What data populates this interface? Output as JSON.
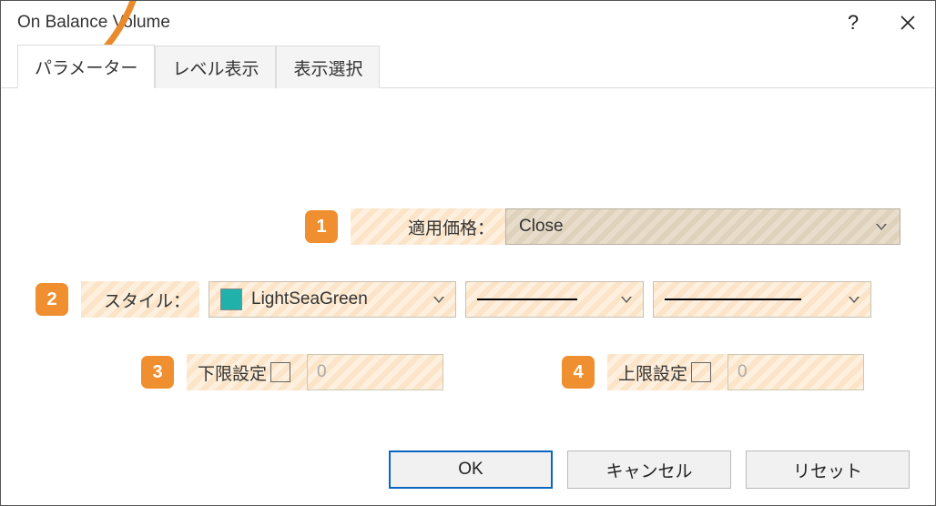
{
  "window": {
    "title": "On Balance Volume"
  },
  "tabs": {
    "parameters": "パラメーター",
    "levels": "レベル表示",
    "display": "表示選択"
  },
  "callouts": {
    "c1": "1",
    "c2": "2",
    "c3": "3",
    "c4": "4"
  },
  "row1": {
    "label": "適用価格：",
    "value": "Close"
  },
  "row2": {
    "label": "スタイル：",
    "color_name": "LightSeaGreen",
    "color_hex": "#20b2aa"
  },
  "limits": {
    "lower_label": "下限設定",
    "lower_value": "0",
    "upper_label": "上限設定",
    "upper_value": "0"
  },
  "buttons": {
    "ok": "OK",
    "cancel": "キャンセル",
    "reset": "リセット"
  }
}
